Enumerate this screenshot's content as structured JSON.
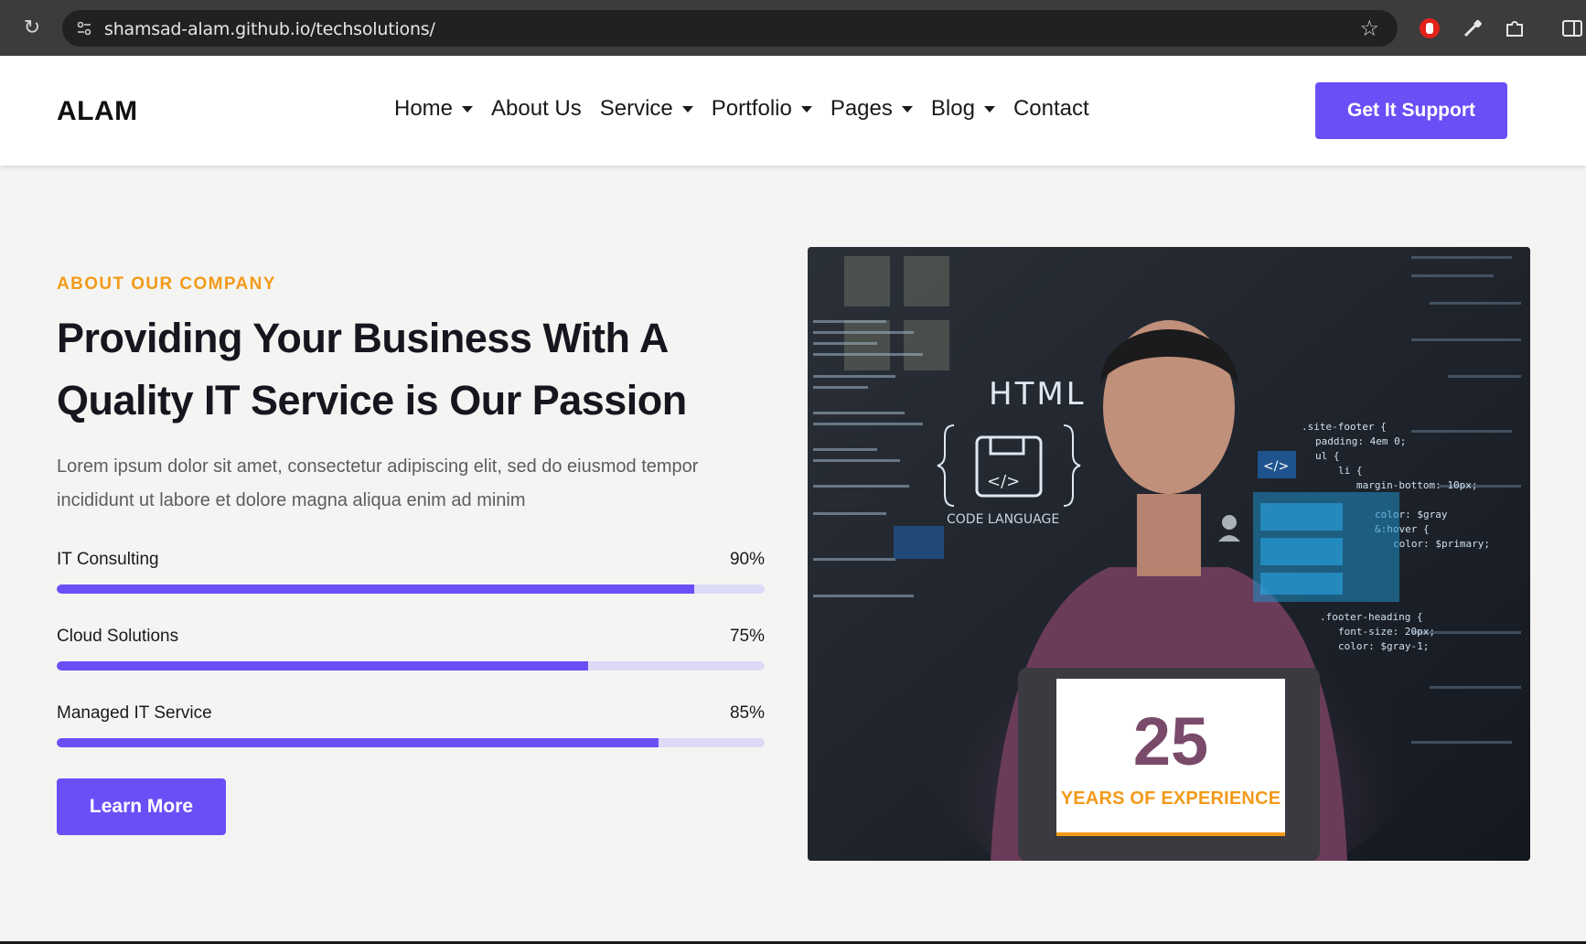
{
  "browser": {
    "url": "shamsad-alam.github.io/techsolutions/"
  },
  "header": {
    "logo": "ALAM",
    "nav": [
      {
        "label": "Home",
        "dropdown": true
      },
      {
        "label": "About Us",
        "dropdown": false
      },
      {
        "label": "Service",
        "dropdown": true
      },
      {
        "label": "Portfolio",
        "dropdown": true
      },
      {
        "label": "Pages",
        "dropdown": true
      },
      {
        "label": "Blog",
        "dropdown": true
      },
      {
        "label": "Contact",
        "dropdown": false
      }
    ],
    "cta_label": "Get It Support"
  },
  "about": {
    "eyebrow": "ABOUT OUR COMPANY",
    "headline": "Providing Your Business With A Quality IT Service is Our Passion",
    "lead": "Lorem ipsum dolor sit amet, consectetur adipiscing elit, sed do eiusmod tempor incididunt ut labore et dolore magna aliqua enim ad minim",
    "skills": [
      {
        "name": "IT Consulting",
        "percent_label": "90%",
        "value": 90
      },
      {
        "name": "Cloud Solutions",
        "percent_label": "75%",
        "value": 75
      },
      {
        "name": "Managed IT Service",
        "percent_label": "85%",
        "value": 85
      }
    ],
    "button_label": "Learn More"
  },
  "hero_image": {
    "overlay_title": "HTML",
    "overlay_caption": "CODE LANGUAGE",
    "experience_number": "25",
    "experience_label": "YEARS OF EXPERIENCE"
  },
  "colors": {
    "accent": "#6c4ef7",
    "orange": "#f39a1a",
    "track": "#dcdaf7"
  }
}
